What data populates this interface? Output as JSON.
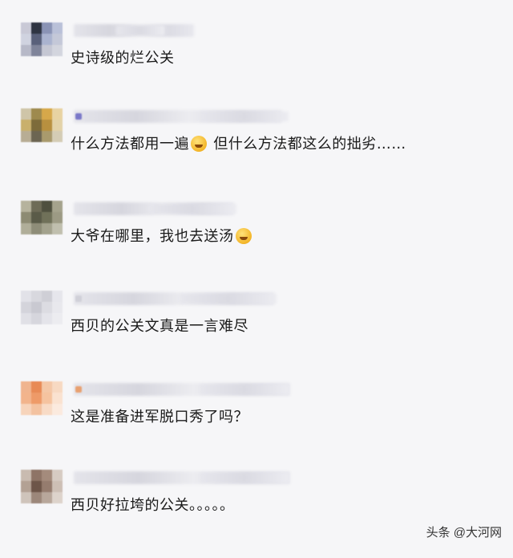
{
  "comments": [
    {
      "text": "史诗级的烂公关",
      "emoji": false,
      "avatar_colors": [
        "#c9c9d6",
        "#2e3442",
        "#8a93b5",
        "#b9c0d8",
        "#d0d3e0",
        "#59607a",
        "#aab3cf",
        "#c4c8d8",
        "#b7b9c8",
        "#7f849a",
        "#c5c7d3",
        "#d3d5de"
      ]
    },
    {
      "text": "什么方法都用一遍",
      "text_after": "但什么方法都这么的拙劣……",
      "emoji": true,
      "emoji_name": "crying-laughing-face-icon",
      "avatar_colors": [
        "#cfc5a8",
        "#9e8a4e",
        "#d6a84a",
        "#e8d3a2",
        "#c9b06c",
        "#7d6b3a",
        "#b8903f",
        "#e3d2a8",
        "#b8ad94",
        "#6c6552",
        "#a99a6d",
        "#d4ccb5"
      ]
    },
    {
      "text": "大爷在哪里，我也去送汤",
      "emoji": true,
      "emoji_name": "laughing-face-icon",
      "avatar_colors": [
        "#b6b39d",
        "#6e6c57",
        "#4f503f",
        "#a5a38d",
        "#8d8b73",
        "#5a5b48",
        "#707159",
        "#9c9a84",
        "#b0ae99",
        "#8e8d78",
        "#a3a28d",
        "#c0bfae"
      ]
    },
    {
      "text": "西贝的公关文真是一言难尽",
      "emoji": false,
      "avatar_colors": [
        "#e2e2e8",
        "#d8d8de",
        "#cfcfd6",
        "#e6e6ec",
        "#d4d4db",
        "#c9c9d1",
        "#dcdce2",
        "#e8e8ed",
        "#e0e0e6",
        "#d6d6dd",
        "#e4e4ea",
        "#ececf0"
      ]
    },
    {
      "text": "这是准备进军脱口秀了吗？",
      "emoji": false,
      "avatar_colors": [
        "#f0b48e",
        "#e88a55",
        "#f4c7a6",
        "#f7d9c2",
        "#f2b48c",
        "#ee9a68",
        "#f5c39f",
        "#fae2d0",
        "#f7d4bb",
        "#f3c2a0",
        "#f8dbc6",
        "#fbeade"
      ]
    },
    {
      "text": "西贝好拉垮的公关。。。。。",
      "emoji": false,
      "avatar_colors": [
        "#c9bbb0",
        "#8e7466",
        "#a48b7c",
        "#d6cbc2",
        "#b3a194",
        "#6d5548",
        "#957c6e",
        "#cdbfb5",
        "#cfc4bb",
        "#9c877a",
        "#b8a79b",
        "#ddd3cb"
      ]
    }
  ],
  "watermark": "头条 @大河网"
}
